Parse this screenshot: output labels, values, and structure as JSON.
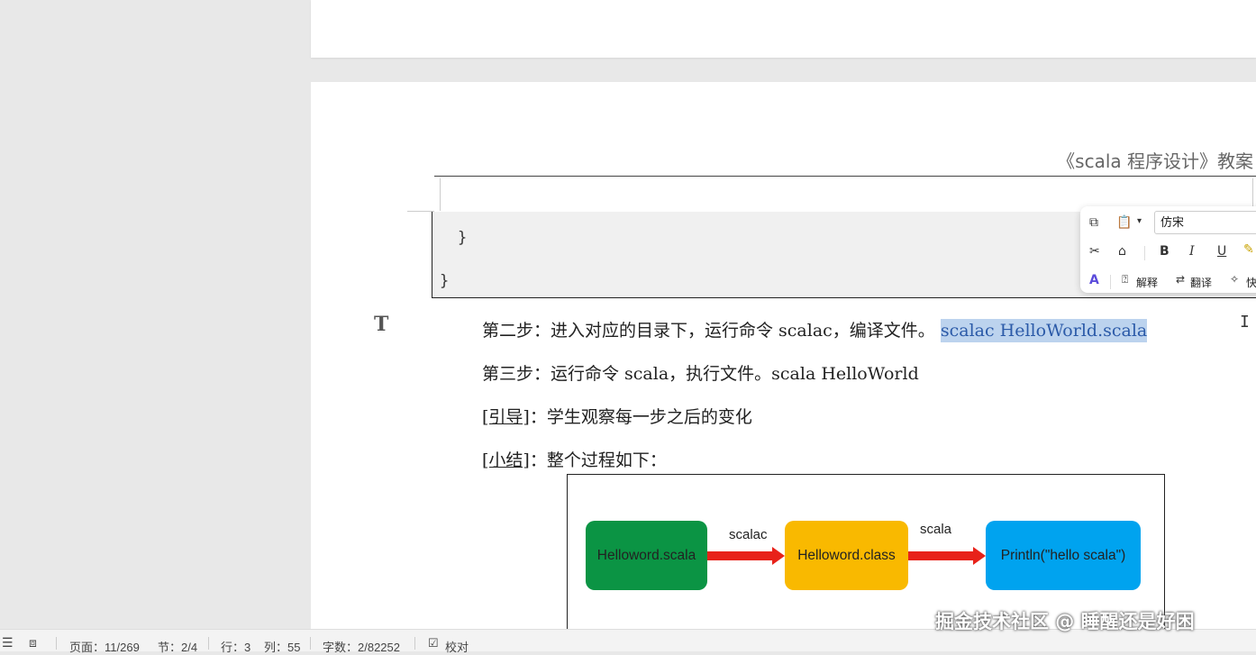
{
  "document": {
    "header_title": "《scala 程序设计》教案",
    "code_lines": [
      "}",
      "}"
    ],
    "step2_prefix": "第二步：进入对应的目录下，运行命令 scalac，编译文件。 ",
    "step2_selected": "scalac HelloWorld.scala",
    "step3": "第三步：运行命令 scala，执行文件。scala HelloWorld",
    "guide_tag": "[引导]",
    "guide_text": "：学生观察每一步之后的变化",
    "summary_tag": "[小结]",
    "summary_text": "：整个过程如下："
  },
  "diagram": {
    "nodes": [
      {
        "label": "Helloword.scala",
        "color": "#0b9444"
      },
      {
        "label": "Helloword.class",
        "color": "#f9b900"
      },
      {
        "label": "Println(\"hello scala\")",
        "color": "#00a3ef"
      }
    ],
    "edges": [
      {
        "label": "scalac"
      },
      {
        "label": "scala"
      }
    ],
    "arrow_color": "#e8221a"
  },
  "mini_toolbar": {
    "font_name": "仿宋",
    "explain_label": "解释",
    "translate_label": "翻译",
    "quick_label": "快",
    "bold": "B",
    "italic": "I",
    "underline": "U"
  },
  "status_bar": {
    "page": "页面：11/269",
    "section": "节：2/4",
    "row": "行：3",
    "col": "列：55",
    "word_count": "字数：2/82252",
    "proofread": "校对"
  },
  "watermark": "掘金技术社区 @ 睡醒还是好困"
}
